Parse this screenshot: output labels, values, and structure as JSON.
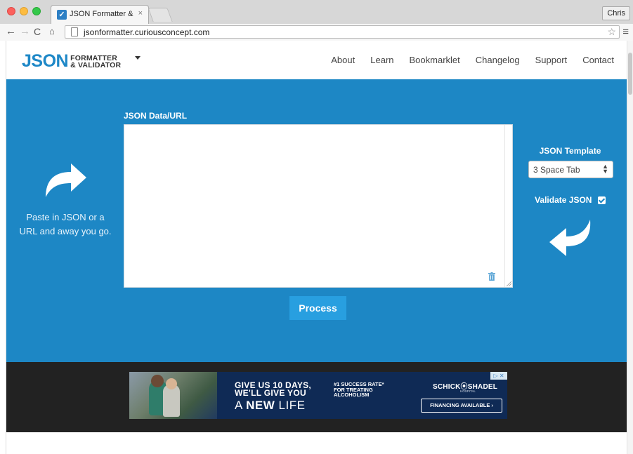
{
  "browser": {
    "tab_title": "JSON Formatter & Validato",
    "tab_close": "×",
    "profile_name": "Chris",
    "url": "jsonformatter.curiousconcept.com"
  },
  "header": {
    "logo_json": "JSON",
    "logo_line1": "FORMATTER",
    "logo_line2": "& VALIDATOR",
    "nav": [
      "About",
      "Learn",
      "Bookmarklet",
      "Changelog",
      "Support",
      "Contact"
    ]
  },
  "hero": {
    "instructions": "Paste in JSON or a URL and away you go.",
    "data_label": "JSON Data/URL",
    "data_value": "",
    "process_label": "Process",
    "template_label": "JSON Template",
    "template_selected": "3 Space Tab",
    "validate_label": "Validate JSON",
    "validate_checked": true
  },
  "ad": {
    "headline_1": "GIVE US 10 DAYS,",
    "headline_2": "WE'LL GIVE YOU",
    "headline_3a": "A ",
    "headline_3b": "NEW",
    "headline_3c": " LIFE",
    "stat_1": "#1 SUCCESS RATE*",
    "stat_2": "FOR TREATING",
    "stat_3": "ALCOHOLISM",
    "brand": "SCHICK⦿SHADEL",
    "brand_sub": "HOSPITAL",
    "cta": "FINANCING AVAILABLE ›",
    "choices": "▷ ✕"
  },
  "colors": {
    "hero_bg": "#1d87c5",
    "button_bg": "#289fe0",
    "logo_blue": "#1e88c7",
    "ad_band": "#222222"
  },
  "icons": {
    "left_arrow": "curved-arrow-right-icon",
    "right_arrow": "curved-arrow-left-icon",
    "trash": "trash-icon"
  }
}
